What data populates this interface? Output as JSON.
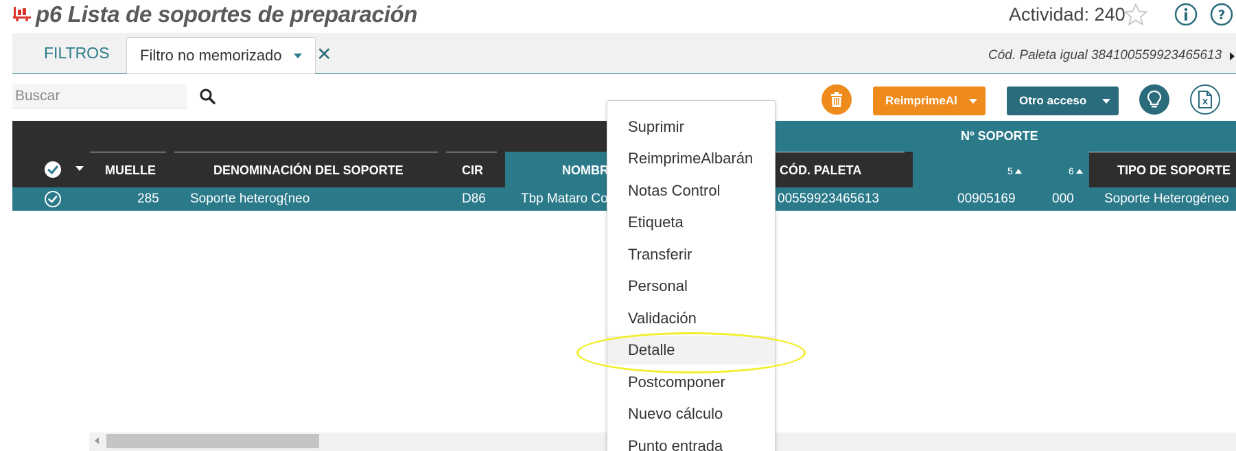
{
  "header": {
    "title": "p6 Lista de soportes de preparación",
    "activity_label": "Actividad: 240",
    "icons": [
      "star-icon",
      "info-icon",
      "help-icon"
    ]
  },
  "filters": {
    "label": "FILTROS",
    "selected": "Filtro no memorizado",
    "summary": "Cód. Paleta igual 384100559923465613"
  },
  "search": {
    "placeholder": "Buscar",
    "value": ""
  },
  "toolbar": {
    "reimprime_label": "ReimprimeAl",
    "otro_acceso_label": "Otro acceso"
  },
  "table": {
    "group_header": "Nº SOPORTE",
    "columns": {
      "muelle": "MUELLE",
      "denominacion": "DENOMINACIÓN DEL SOPORTE",
      "cir": "CIR",
      "nombre": "NOMBR",
      "cod_paleta": "CÓD. PALETA",
      "col5": "5",
      "col6": "6",
      "tipo": "TIPO DE SOPORTE"
    },
    "rows": [
      {
        "muelle": "285",
        "denominacion": "Soporte heterog{neo",
        "cir": "D86",
        "nombre": "Tbp Mataro Co",
        "cod_paleta": "00559923465613",
        "soporte_5": "00905169",
        "soporte_6": "000",
        "tipo": "Soporte Heterogéneo"
      }
    ]
  },
  "context_menu": {
    "items": [
      "Suprimir",
      "ReimprimeAlbarán",
      "Notas Control",
      "Etiqueta",
      "Transferir",
      "Personal",
      "Validación",
      "Detalle",
      "Postcomponer",
      "Nuevo cálculo",
      "Punto entrada"
    ],
    "highlighted": "Detalle"
  },
  "colors": {
    "teal": "#2a7a8a",
    "orange": "#ef8b1c",
    "header_dark": "#2e2e2e",
    "highlight": "#f2ee2a"
  }
}
